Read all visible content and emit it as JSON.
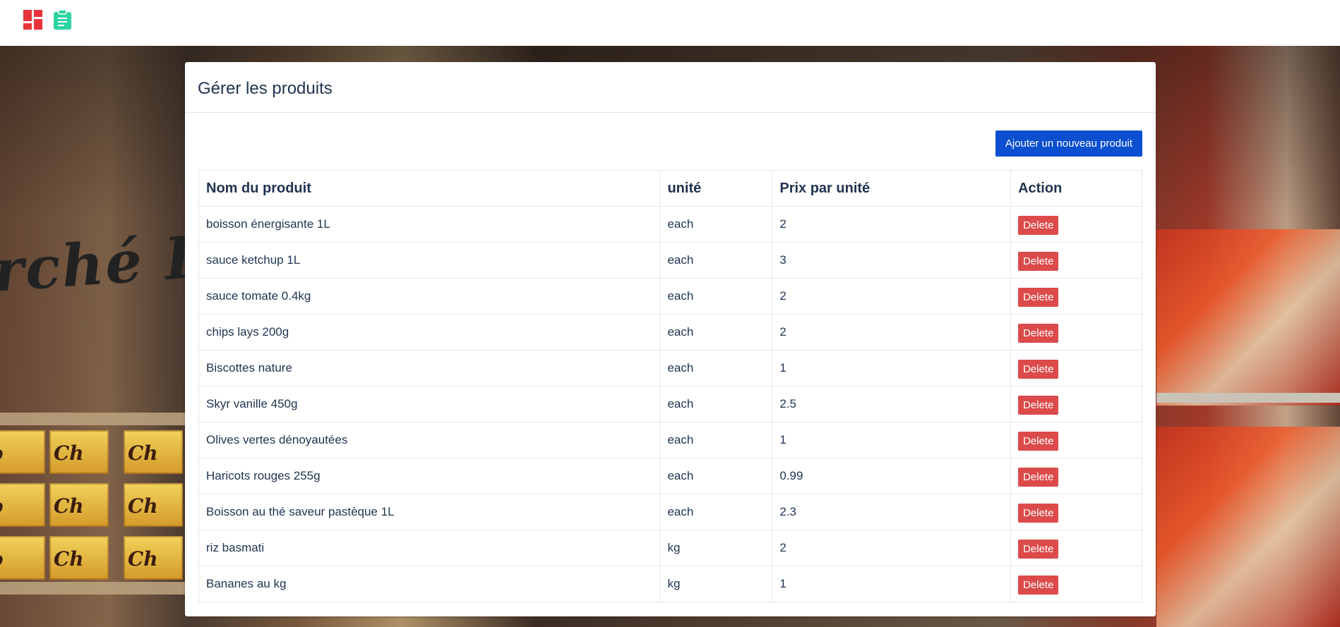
{
  "topbar": {
    "icons": [
      "dashboard-icon",
      "clipboard-icon"
    ],
    "colors": {
      "dashboard": "#e8333a",
      "clipboard": "#2dd4a0"
    }
  },
  "page": {
    "title": "Gérer les produits",
    "add_button_label": "Ajouter un nouveau produit"
  },
  "table": {
    "headers": {
      "name": "Nom du produit",
      "unit": "unité",
      "price": "Prix par unité",
      "action": "Action"
    },
    "delete_label": "Delete",
    "rows": [
      {
        "name": "boisson énergisante 1L",
        "unit": "each",
        "price": "2"
      },
      {
        "name": "sauce ketchup 1L",
        "unit": "each",
        "price": "3"
      },
      {
        "name": "sauce tomate 0.4kg",
        "unit": "each",
        "price": "2"
      },
      {
        "name": "chips lays 200g",
        "unit": "each",
        "price": "2"
      },
      {
        "name": "Biscottes nature",
        "unit": "each",
        "price": "1"
      },
      {
        "name": "Skyr vanille 450g",
        "unit": "each",
        "price": "2.5"
      },
      {
        "name": "Olives vertes dénoyautées",
        "unit": "each",
        "price": "1"
      },
      {
        "name": "Haricots rouges 255g",
        "unit": "each",
        "price": "0.99"
      },
      {
        "name": "Boisson au thé saveur pastèque 1L",
        "unit": "each",
        "price": "2.3"
      },
      {
        "name": "riz basmati",
        "unit": "kg",
        "price": "2"
      },
      {
        "name": "Bananes au kg",
        "unit": "kg",
        "price": "1"
      }
    ]
  },
  "colors": {
    "primary_button": "#0b4fd1",
    "delete_button": "#dc4a4a",
    "text": "#1f3350"
  }
}
